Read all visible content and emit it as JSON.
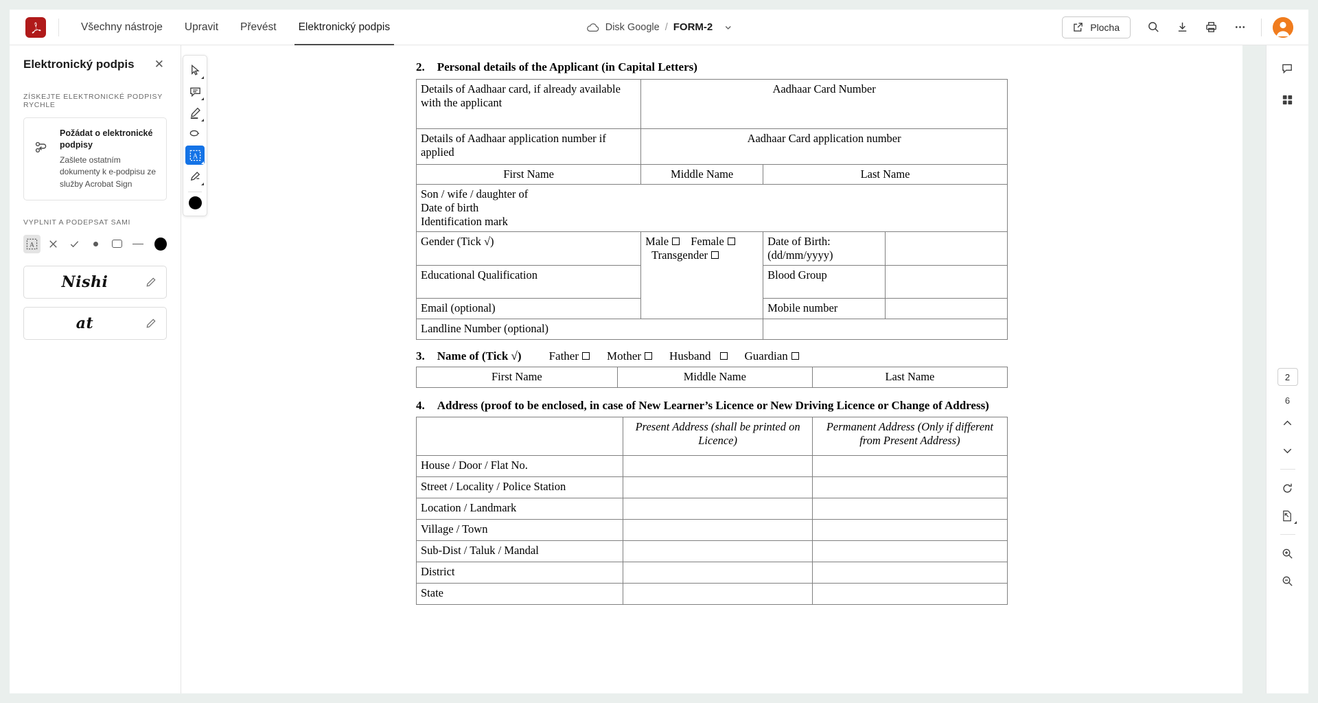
{
  "app": {
    "logo_icon": "adobe-acrobat-logo",
    "menu": [
      {
        "label": "Všechny nástroje",
        "active": false
      },
      {
        "label": "Upravit",
        "active": false
      },
      {
        "label": "Převést",
        "active": false
      },
      {
        "label": "Elektronický podpis",
        "active": true
      }
    ],
    "breadcrumb": {
      "cloud_icon": "cloud-icon",
      "storage": "Disk Google",
      "separator": "/",
      "filename": "FORM-2",
      "chevron_icon": "chevron-down-icon"
    },
    "toolbar_right": {
      "share_label": "Plocha",
      "share_icon": "share-external-icon",
      "search_icon": "search-icon",
      "download_icon": "download-icon",
      "print_icon": "print-icon",
      "more_icon": "more-ellipsis-icon",
      "avatar_icon": "user-avatar"
    }
  },
  "sidebar": {
    "title": "Elektronický podpis",
    "close_icon": "close-icon",
    "section_request": "ZÍSKEJTE ELEKTRONICKÉ PODPISY RYCHLE",
    "request_card": {
      "icon": "request-signature-icon",
      "title": "Požádat o elektronické podpisy",
      "description": "Zašlete ostatním dokumenty k e-podpisu ze služby Acrobat Sign"
    },
    "section_fill": "VYPLNIT A PODEPSAT SAMI",
    "tools": [
      {
        "name": "add-text-tool",
        "glyph": "A",
        "selected": true
      },
      {
        "name": "cross-mark-tool",
        "glyph": "X",
        "selected": false
      },
      {
        "name": "check-mark-tool",
        "glyph": "✓",
        "selected": false
      },
      {
        "name": "dot-tool",
        "glyph": "•",
        "selected": false
      },
      {
        "name": "rectangle-tool",
        "glyph": "▭",
        "selected": false
      },
      {
        "name": "line-tool",
        "glyph": "—",
        "selected": false
      }
    ],
    "color_swatch": "#000000",
    "signatures": [
      {
        "name": "signature-nishi",
        "text": "Nishi",
        "edit_icon": "pencil-icon"
      },
      {
        "name": "signature-at",
        "text": "at",
        "edit_icon": "pencil-icon"
      }
    ]
  },
  "palette": {
    "items": [
      {
        "name": "select-cursor-tool",
        "icon": "cursor-arrow-icon",
        "active": false,
        "caret": true
      },
      {
        "name": "comment-tool",
        "icon": "comment-bubble-icon",
        "active": false,
        "caret": true
      },
      {
        "name": "highlight-tool",
        "icon": "highlighter-icon",
        "active": false,
        "caret": true
      },
      {
        "name": "draw-freehand-tool",
        "icon": "lasso-scribble-icon",
        "active": false,
        "caret": false
      },
      {
        "name": "fill-and-sign-tool",
        "icon": "add-text-box-icon",
        "active": true,
        "caret": true
      },
      {
        "name": "sign-tool",
        "icon": "sign-pen-icon",
        "active": false,
        "caret": true
      }
    ],
    "color_swatch": "#000000"
  },
  "right_rail": {
    "comment_icon": "comment-panel-icon",
    "thumbnails_icon": "page-thumbnails-icon",
    "current_page": "2",
    "total_pages": "6",
    "prev_icon": "chevron-up-icon",
    "next_icon": "chevron-down-icon",
    "rotate_icon": "rotate-clockwise-icon",
    "fit_page_icon": "fit-page-icon",
    "zoom_in_icon": "zoom-in-icon",
    "zoom_out_icon": "zoom-out-icon"
  },
  "document": {
    "section2": {
      "number": "2.",
      "heading": "Personal details of the Applicant (in Capital Letters)",
      "rows": {
        "aadhaar_label": "Details of Aadhaar card, if already available with the applicant",
        "aadhaar_value": "Aadhaar Card Number",
        "aadhaar_app_label": "Details of Aadhaar application number if applied",
        "aadhaar_app_value": "Aadhaar Card application number",
        "name_headers": [
          "First Name",
          "Middle Name",
          "Last Name"
        ],
        "relation_lines": [
          "Son / wife / daughter of",
          "Date of birth",
          "Identification mark"
        ],
        "gender_label": "Gender (Tick √)",
        "gender_options": [
          "Male",
          "Female",
          "Transgender"
        ],
        "dob_label": "Date of Birth: (dd/mm/yyyy)",
        "education_label": "Educational Qualification",
        "blood_label": "Blood Group",
        "email_label": "Email (optional)",
        "mobile_label": "Mobile number",
        "landline_label": "Landline Number (optional)"
      }
    },
    "section3": {
      "number": "3.",
      "heading": "Name of (Tick √)",
      "options": [
        "Father",
        "Mother",
        "Husband",
        "Guardian"
      ],
      "name_headers": [
        "First Name",
        "Middle Name",
        "Last Name"
      ]
    },
    "section4": {
      "number": "4.",
      "heading": "Address (proof to be enclosed, in case of New Learner’s Licence or New Driving Licence or Change of Address)",
      "col_headers": [
        "",
        "Present Address (shall be printed on Licence)",
        "Permanent Address (Only if different from Present Address)"
      ],
      "rows": [
        "House / Door / Flat No.",
        "Street / Locality / Police Station",
        "Location / Landmark",
        "Village / Town",
        "Sub-Dist / Taluk / Mandal",
        "District",
        "State"
      ]
    }
  }
}
